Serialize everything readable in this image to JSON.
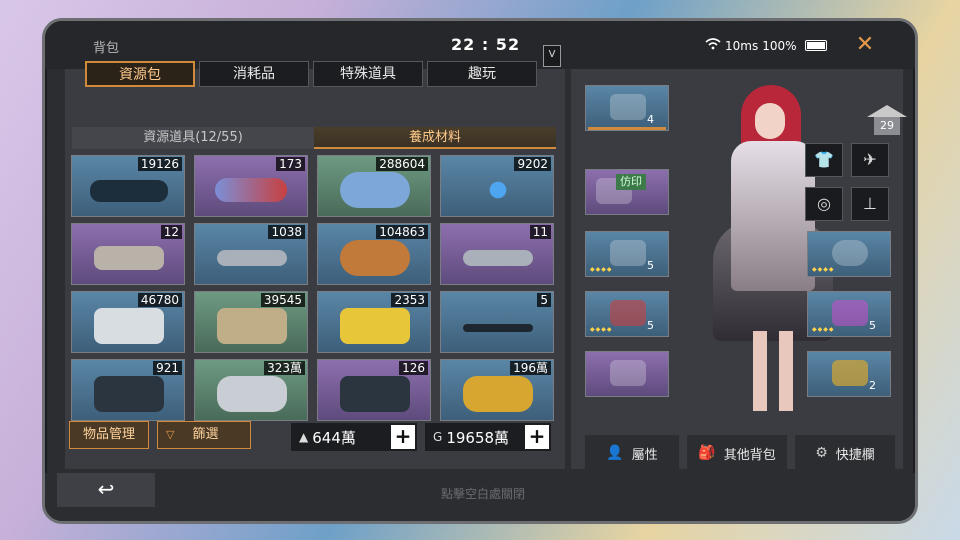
{
  "header": {
    "title": "背包",
    "clock": "22 : 52",
    "latency": "10ms",
    "battery": "100%"
  },
  "tabs": [
    {
      "label": "資源包",
      "active": true
    },
    {
      "label": "消耗品",
      "active": false
    },
    {
      "label": "特殊道具",
      "active": false
    },
    {
      "label": "趣玩",
      "active": false
    }
  ],
  "vip_badge": "V",
  "subtabs": [
    {
      "label": "資源道具(12/55)",
      "active": false
    },
    {
      "label": "養成材料",
      "active": true
    }
  ],
  "items": [
    {
      "count": "19126",
      "quality": "blue"
    },
    {
      "count": "173",
      "quality": "purple"
    },
    {
      "count": "288604",
      "quality": "green"
    },
    {
      "count": "9202",
      "quality": "blue"
    },
    {
      "count": "12",
      "quality": "purple"
    },
    {
      "count": "1038",
      "quality": "blue"
    },
    {
      "count": "104863",
      "quality": "blue"
    },
    {
      "count": "11",
      "quality": "purple"
    },
    {
      "count": "46780",
      "quality": "blue"
    },
    {
      "count": "39545",
      "quality": "green"
    },
    {
      "count": "2353",
      "quality": "blue"
    },
    {
      "count": "5",
      "quality": "blue"
    },
    {
      "count": "921",
      "quality": "blue"
    },
    {
      "count": "323萬",
      "quality": "green"
    },
    {
      "count": "126",
      "quality": "purple"
    },
    {
      "count": "196萬",
      "quality": "blue"
    }
  ],
  "buttons": {
    "manage": "物品管理",
    "filter": "篩選",
    "attributes": "屬性",
    "other_bag": "其他背包",
    "quickbar": "快捷欄"
  },
  "currency": {
    "silver": "644萬",
    "gold": "19658萬",
    "gold_symbol": "G"
  },
  "hint": "點擊空白處關閉",
  "character": {
    "house_level": "29",
    "equip_slots": [
      {
        "level": "4"
      },
      {
        "tag": "仿印"
      },
      {
        "level": "5"
      },
      {
        "level": "5"
      },
      {
        "level": ""
      },
      {
        "level": ""
      },
      {
        "level": "5"
      },
      {
        "level": "2"
      }
    ]
  },
  "colors": {
    "accent": "#d08a3c",
    "panel": "#3a3c41",
    "frame": "#2b2d31"
  }
}
